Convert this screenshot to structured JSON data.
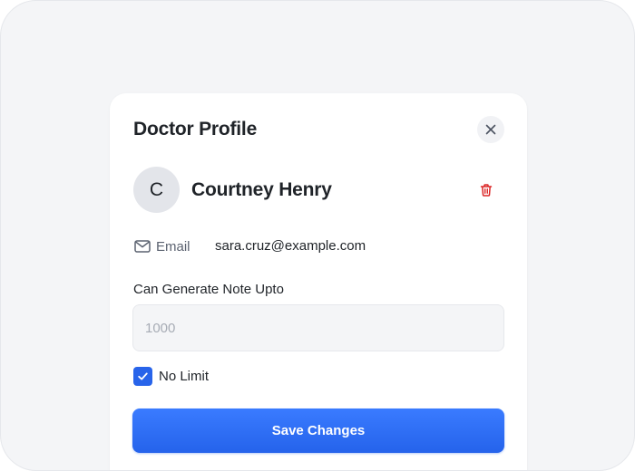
{
  "dialog": {
    "title": "Doctor Profile"
  },
  "user": {
    "avatar_initial": "C",
    "name": "Courtney Henry"
  },
  "email": {
    "label": "Email",
    "value": "sara.cruz@example.com"
  },
  "note_limit": {
    "label": "Can Generate Note Upto",
    "value": "",
    "placeholder": "1000"
  },
  "no_limit": {
    "label": "No Limit",
    "checked": true
  },
  "actions": {
    "save_label": "Save Changes"
  },
  "icons": {
    "close": "close-icon",
    "delete": "trash-icon",
    "email": "mail-icon",
    "checkbox": "check-icon"
  },
  "colors": {
    "primary": "#2563eb",
    "danger": "#dc2626",
    "frame_background": "#f4f5f7",
    "card_background": "#ffffff"
  }
}
